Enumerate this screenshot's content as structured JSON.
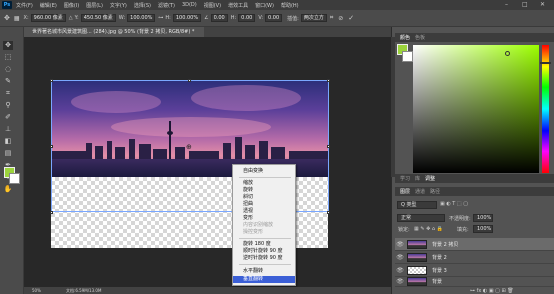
{
  "app": {
    "logo": "Ps"
  },
  "menu": [
    "文件(F)",
    "编辑(E)",
    "图像(I)",
    "图层(L)",
    "文字(Y)",
    "选择(S)",
    "滤镜(T)",
    "3D(D)",
    "视图(V)",
    "增效工具",
    "窗口(W)",
    "帮助(H)"
  ],
  "options": {
    "x_label": "X:",
    "x_value": "960.00 像素",
    "y_label": "Y:",
    "y_value": "450.50 像素",
    "w_label": "W:",
    "w_value": "100.00%",
    "h_label": "H:",
    "h_value": "100.00%",
    "angle_value": "0.00",
    "hskew_label": "H:",
    "hskew_value": "0.00",
    "vskew_label": "V:",
    "vskew_value": "0.00",
    "interp_value": "两次立方"
  },
  "document_tab": "世界著名城市风景建筑图... (284).jpg @ 50% (背景 2 拷贝, RGB/8#) *",
  "context_menu": {
    "items": [
      {
        "label": "自由变换",
        "disabled": false,
        "selected": false
      },
      {
        "label": "缩放",
        "disabled": false,
        "selected": false
      },
      {
        "label": "旋转",
        "disabled": false,
        "selected": false
      },
      {
        "label": "斜切",
        "disabled": false,
        "selected": false
      },
      {
        "label": "扭曲",
        "disabled": false,
        "selected": false
      },
      {
        "label": "透视",
        "disabled": false,
        "selected": false
      },
      {
        "label": "变形",
        "disabled": false,
        "selected": false
      },
      {
        "label": "内容识别缩放",
        "disabled": true,
        "selected": false
      },
      {
        "label": "操控变形",
        "disabled": true,
        "selected": false
      },
      {
        "label": "旋转 180 度",
        "disabled": false,
        "selected": false
      },
      {
        "label": "顺时针旋转 90 度",
        "disabled": false,
        "selected": false
      },
      {
        "label": "逆时针旋转 90 度",
        "disabled": false,
        "selected": false
      },
      {
        "label": "水平翻转",
        "disabled": false,
        "selected": false
      },
      {
        "label": "垂直翻转",
        "disabled": false,
        "selected": true
      }
    ]
  },
  "status": {
    "zoom": "50%",
    "doc_info": "文档:6.59M/13.0M"
  },
  "color_panel": {
    "tabs": [
      "颜色",
      "色板"
    ],
    "fg": "#9cd43c",
    "bg": "#ffffff"
  },
  "adjust_panel": {
    "tabs": [
      "学习",
      "库",
      "调整"
    ]
  },
  "layers_panel": {
    "tabs": [
      "图层",
      "通道",
      "路径"
    ],
    "kind_label": "Q 类型",
    "blend_mode": "正常",
    "opacity_label": "不透明度:",
    "opacity_value": "100%",
    "lock_label": "锁定:",
    "fill_label": "填充:",
    "fill_value": "100%",
    "layers": [
      {
        "name": "背景 2 拷贝",
        "active": true,
        "thumb": "photo"
      },
      {
        "name": "背景 2",
        "active": false,
        "thumb": "photo"
      },
      {
        "name": "背景 3",
        "active": false,
        "thumb": "trans"
      },
      {
        "name": "背景",
        "active": false,
        "thumb": "photo"
      }
    ]
  }
}
